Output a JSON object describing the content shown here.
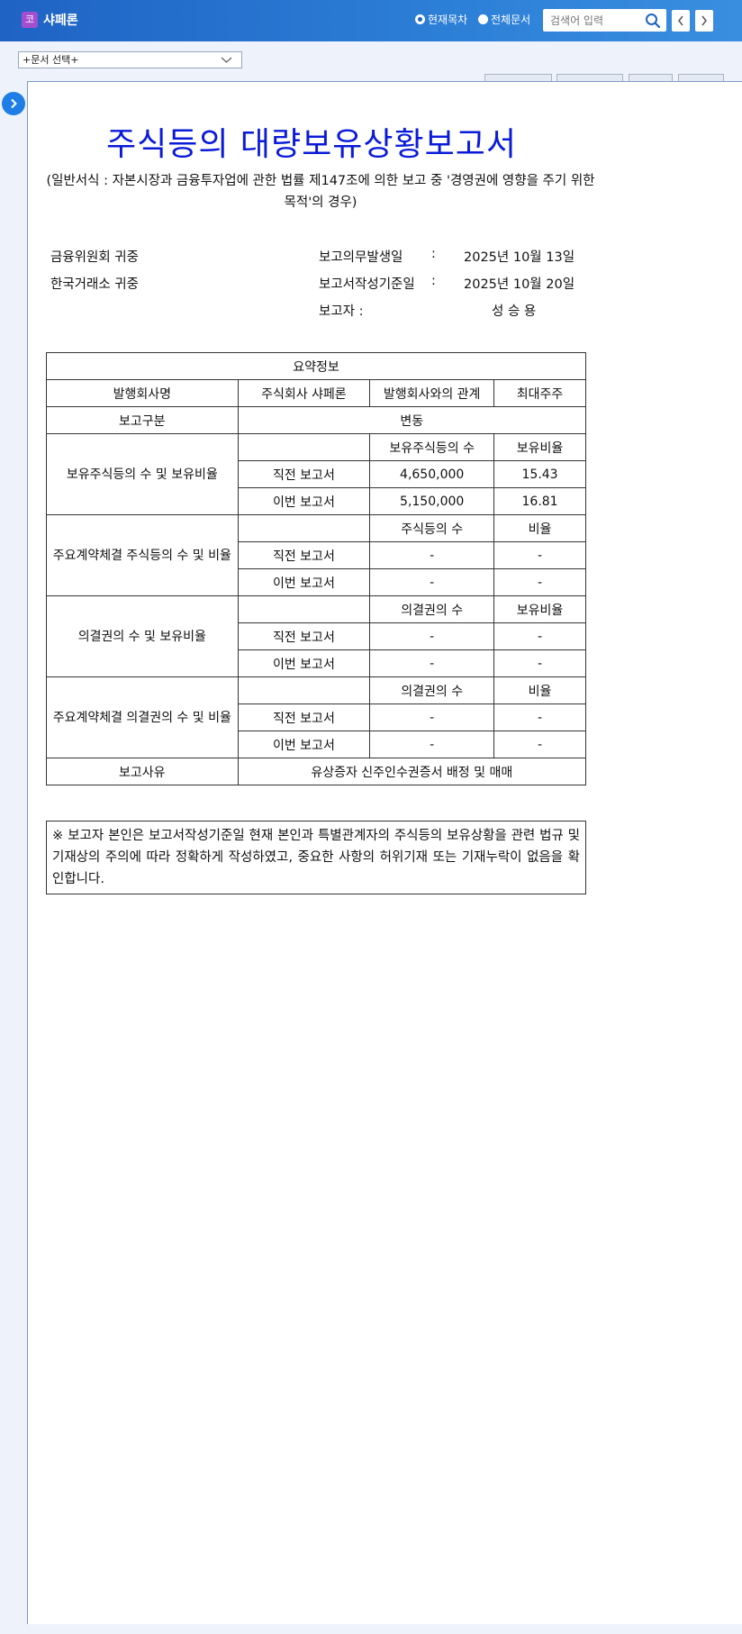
{
  "header": {
    "logo_char": "코",
    "company_name": "샤페론",
    "radio_current": "현재목차",
    "radio_all": "전체문서",
    "search_placeholder": "검색어 입력"
  },
  "doc_select": {
    "value": "+문서 선택+"
  },
  "document": {
    "title": "주식등의 대량보유상황보고서",
    "subtitle": "(일반서식 : 자본시장과 금융투자업에 관한 법률 제147조에 의한 보고 중 '경영권에 영향을 주기 위한 목적'의 경우)",
    "recipient1": "금융위원회 귀중",
    "recipient2": "한국거래소 귀중",
    "obligation_label": "보고의무발생일",
    "obligation_date": "2025년 10월 13일",
    "base_label": "보고서작성기준일",
    "base_date": "2025년 10월 20일",
    "reporter_label": "보고자 :",
    "reporter_name": "성 승 용",
    "colon": ":"
  },
  "table": {
    "summary_title": "요약정보",
    "issuer_label": "발행회사명",
    "issuer_name": "주식회사 샤페론",
    "relation_label": "발행회사와의 관계",
    "relation_value": "최대주주",
    "report_type_label": "보고구분",
    "report_type_value": "변동",
    "prev_report": "직전 보고서",
    "this_report": "이번 보고서",
    "dash": "-",
    "holding": {
      "label": "보유주식등의 수 및 보유비율",
      "col1": "보유주식등의 수",
      "col2": "보유비율",
      "prev_shares": "4,650,000",
      "prev_ratio": "15.43",
      "this_shares": "5,150,000",
      "this_ratio": "16.81"
    },
    "contract_shares": {
      "label": "주요계약체결 주식등의 수 및 비율",
      "col1": "주식등의 수",
      "col2": "비율"
    },
    "voting": {
      "label": "의결권의 수 및 보유비율",
      "col1": "의결권의 수",
      "col2": "보유비율"
    },
    "contract_voting": {
      "label": "주요계약체결 의결권의 수 및 비율",
      "col1": "의결권의 수",
      "col2": "비율"
    },
    "reason_label": "보고사유",
    "reason_value": "유상증자 신주인수권증서 배정 및 매매"
  },
  "notice": "※ 보고자 본인은 보고서작성기준일 현재 본인과 특별관계자의 주식등의 보유상황을 관련 법규 및 기재상의 주의에 따라 정확하게 작성하였고, 중요한 사항의 허위기재 또는 기재누락이 없음을 확인합니다.",
  "colors": {
    "header": "#2c7fd6",
    "title": "#0a1bd8",
    "toggle": "#1e7ee6"
  }
}
